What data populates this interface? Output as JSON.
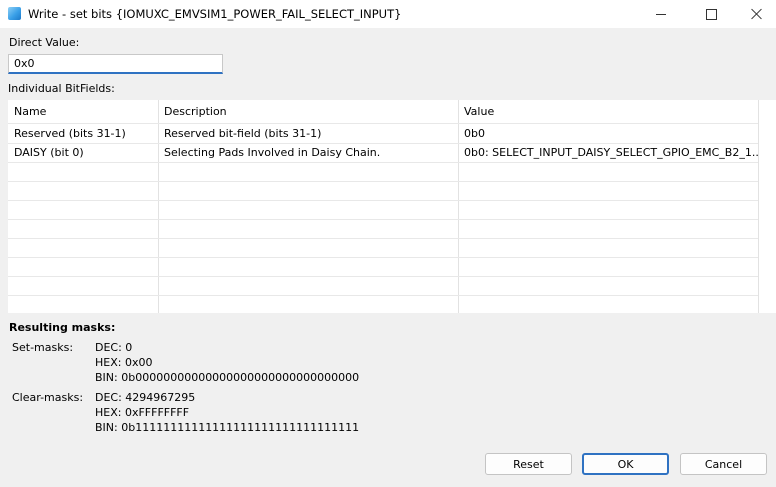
{
  "window": {
    "title": "Write - set bits {IOMUXC_EMVSIM1_POWER_FAIL_SELECT_INPUT}"
  },
  "direct_value": {
    "label": "Direct Value:",
    "value": "0x0"
  },
  "bitfields": {
    "label": "Individual BitFields:",
    "columns": [
      "Name",
      "Description",
      "Value"
    ],
    "rows": [
      [
        "Reserved (bits 31-1)",
        "Reserved bit-field (bits 31-1)",
        "0b0"
      ],
      [
        "DAISY (bit 0)",
        "Selecting Pads Involved in Daisy Chain.",
        "0b0: SELECT_INPUT_DAISY_SELECT_GPIO_EMC_B2_1..."
      ]
    ]
  },
  "masks": {
    "title": "Resulting masks:",
    "set_label": "Set-masks:",
    "set_dec": "DEC: 0",
    "set_hex": "HEX: 0x00",
    "set_bin": "BIN: 0b00000000000000000000000000000000",
    "clear_label": "Clear-masks:",
    "clear_dec": "DEC: 4294967295",
    "clear_hex": "HEX: 0xFFFFFFFF",
    "clear_bin": "BIN: 0b11111111111111111111111111111111"
  },
  "buttons": {
    "reset": "Reset",
    "ok": "OK",
    "cancel": "Cancel"
  },
  "colors": {
    "accent": "#2f72c2",
    "background": "#f0f0f0"
  }
}
